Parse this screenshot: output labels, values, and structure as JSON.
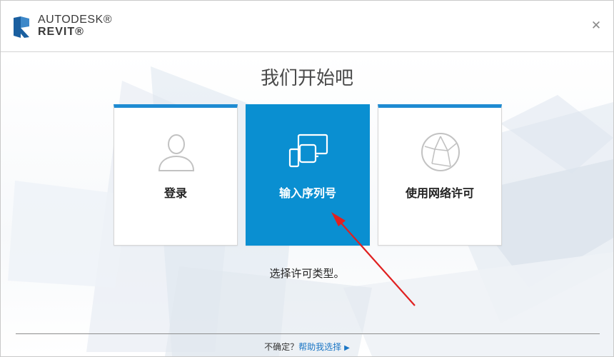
{
  "app": {
    "brand_line1": "AUTODESK®",
    "brand_line2": "REVIT®",
    "logo_letter": "R",
    "close_glyph": "✕"
  },
  "main": {
    "heading": "我们开始吧",
    "cards": [
      {
        "label": "登录",
        "icon": "user-icon",
        "selected": false
      },
      {
        "label": "输入序列号",
        "icon": "devices-icon",
        "selected": true
      },
      {
        "label": "使用网络许可",
        "icon": "network-globe-icon",
        "selected": false
      }
    ],
    "subtext": "选择许可类型。"
  },
  "footer": {
    "question": "不确定？",
    "help_link": "帮助我选择",
    "play_glyph": "▶"
  },
  "colors": {
    "accent": "#1e8bd2",
    "selected_card": "#0a8fd1",
    "link": "#1a75c4",
    "annotation_arrow": "#e02020"
  }
}
